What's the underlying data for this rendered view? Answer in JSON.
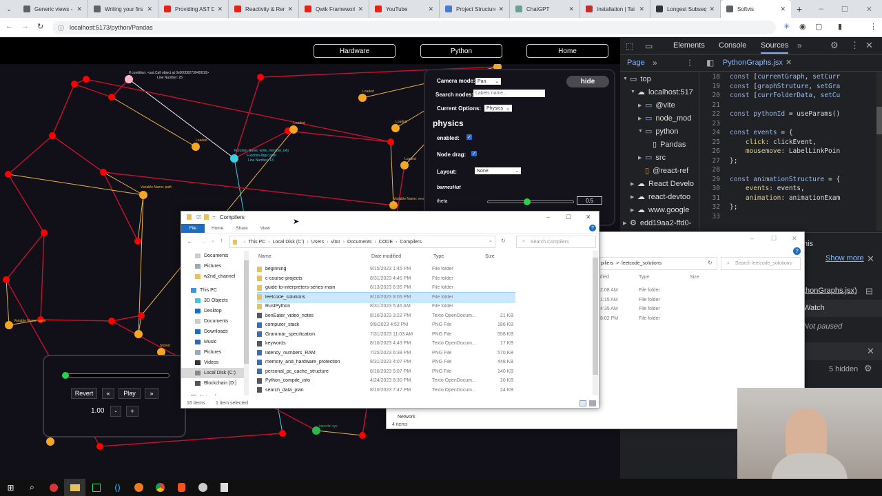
{
  "browser": {
    "tabs": [
      {
        "title": "Generic views - ",
        "icon": "globe-icon",
        "color": "#5f6368"
      },
      {
        "title": "Writing your firs",
        "icon": "globe-icon",
        "color": "#5f6368"
      },
      {
        "title": "Providing AST D",
        "icon": "youtube-icon",
        "color": "#e62117"
      },
      {
        "title": "Reactivity & Ren",
        "icon": "youtube-icon",
        "color": "#e62117"
      },
      {
        "title": "Qwik Framework",
        "icon": "youtube-icon",
        "color": "#e62117"
      },
      {
        "title": "YouTube",
        "icon": "youtube-icon",
        "color": "#e62117"
      },
      {
        "title": "Project Structure",
        "icon": "search-icon",
        "color": "#4a7bd0"
      },
      {
        "title": "ChatGPT",
        "icon": "chatgpt-icon",
        "color": "#6aa194"
      },
      {
        "title": "Installation | Tai",
        "icon": "t-icon",
        "color": "#c42d2d"
      },
      {
        "title": "Longest Subseq",
        "icon": "leetcode-icon",
        "color": "#333333"
      },
      {
        "title": "Softvis",
        "icon": "globe-icon",
        "color": "#5f6368",
        "active": true
      }
    ],
    "url": "localhost:5173/python/Pandas"
  },
  "app": {
    "nav": [
      "Hardware",
      "Python",
      "Home"
    ],
    "controls": {
      "camera_label": "Camera mode:",
      "camera_value": "Pan",
      "search_label": "Search nodes:",
      "search_placeholder": "Labels name...",
      "options_label": "Current Options:",
      "options_value": "Physics",
      "hide_label": "hide",
      "section_title": "physics",
      "enabled_label": "enabled:",
      "enabled": true,
      "drag_label": "Node drag:",
      "drag": true,
      "layout_label": "Layout:",
      "layout_value": "None",
      "solver_label": "barnesHut",
      "theta_label": "theta",
      "theta_value": "0.5",
      "theta_fraction": 0.45
    },
    "animation": {
      "progress": 0.0,
      "revert": "Revert",
      "prev": "«",
      "play": "Play",
      "next": "»",
      "speed": "1.00",
      "minus": "-",
      "plus": "+"
    },
    "graph_labels": {
      "if_condition": "If condition: <ast.Call object at 0x0000027304D810>",
      "if_line": "Line Number: 25",
      "function_name": "Function Name: write_member_info",
      "function_args": "Function Args: path",
      "function_line": "Line Number: 13",
      "loaded": "Loaded",
      "stored": "Stored",
      "var_path": "Variable Name: path",
      "var_version": "Variable Name: version",
      "var_open": "Variable Name: open",
      "imports_sys": "imports: sys"
    }
  },
  "explorer": {
    "title": "Compilers",
    "ribbon": [
      "File",
      "Home",
      "Share",
      "View"
    ],
    "breadcrumb": [
      "This PC",
      "Local Disk (C:)",
      "Users",
      "vitor",
      "Documents",
      "CODE",
      "Compilers"
    ],
    "search_placeholder": "Search Compilers",
    "columns": [
      "Name",
      "Date modified",
      "Type",
      "Size"
    ],
    "nav": [
      "Documents",
      "Pictures",
      "w2nd_channel",
      "This PC",
      "3D Objects",
      "Desktop",
      "Documents",
      "Downloads",
      "Music",
      "Pictures",
      "Videos",
      "Local Disk (C:)",
      "Blockchain (D:)",
      "Network"
    ],
    "files": [
      {
        "name": "beginning",
        "date": "9/15/2023 1:45 PM",
        "type": "File folder",
        "size": "",
        "kind": "folder"
      },
      {
        "name": "c-course-projects",
        "date": "8/31/2023 4:45 PM",
        "type": "File folder",
        "size": "",
        "kind": "folder"
      },
      {
        "name": "guide-to-interpreters-series-main",
        "date": "6/13/2023 6:35 PM",
        "type": "File folder",
        "size": "",
        "kind": "folder"
      },
      {
        "name": "leetcode_solutions",
        "date": "8/10/2023 8:05 PM",
        "type": "File folder",
        "size": "",
        "kind": "folder",
        "selected": true
      },
      {
        "name": "RustPython",
        "date": "8/31/2023 5:46 AM",
        "type": "File folder",
        "size": "",
        "kind": "folder"
      },
      {
        "name": "benEater_video_notes",
        "date": "8/16/2023 3:22 PM",
        "type": "Texto OpenDocum...",
        "size": "21 KB",
        "kind": "doc"
      },
      {
        "name": "computer_stack",
        "date": "9/8/2023 4:52 PM",
        "type": "PNG File",
        "size": "186 KB",
        "kind": "png"
      },
      {
        "name": "Grammar_specification",
        "date": "7/31/2023 11:03 AM",
        "type": "PNG File",
        "size": "558 KB",
        "kind": "png"
      },
      {
        "name": "keywords",
        "date": "8/16/2023 4:43 PM",
        "type": "Texto OpenDocum...",
        "size": "17 KB",
        "kind": "doc"
      },
      {
        "name": "latency_numbers_RAM",
        "date": "7/25/2023 6:38 PM",
        "type": "PNG File",
        "size": "570 KB",
        "kind": "png"
      },
      {
        "name": "memory_and_hardware_protection",
        "date": "8/31/2023 4:07 PM",
        "type": "PNG File",
        "size": "448 KB",
        "kind": "png"
      },
      {
        "name": "personal_pc_cache_structure",
        "date": "8/16/2023 5:07 PM",
        "type": "PNG File",
        "size": "140 KB",
        "kind": "png"
      },
      {
        "name": "Python_compile_info",
        "date": "4/24/2023 8:30 PM",
        "type": "Texto OpenDocum...",
        "size": "20 KB",
        "kind": "doc"
      },
      {
        "name": "search_data_plan",
        "date": "8/10/2023 7:47 PM",
        "type": "Texto OpenDocum...",
        "size": "24 KB",
        "kind": "doc"
      }
    ],
    "status_items": "16 items",
    "status_selected": "1 item selected"
  },
  "explorer2": {
    "breadcrumb_tail": "piliers  >  leetcode_solutions",
    "search_placeholder": "Search leetcode_solutions",
    "columns": [
      "ified",
      "Type",
      "Size"
    ],
    "rows": [
      {
        "date": "2:08 AM",
        "type": "File folder"
      },
      {
        "date": "1:15 AM",
        "type": "File folder"
      },
      {
        "date": "4:35 AM",
        "type": "File folder"
      },
      {
        "date": "8:02 PM",
        "type": "File folder"
      }
    ],
    "network": "Network",
    "status": "4 items"
  },
  "devtools": {
    "tabs": [
      "Elements",
      "Console",
      "Sources"
    ],
    "active_tab": "Sources",
    "subtab": "Page",
    "file_tab": "PythonGraphs.jsx",
    "tree": [
      {
        "label": "top",
        "depth": 0,
        "icon": "frame-icon",
        "open": true
      },
      {
        "label": "localhost:517",
        "depth": 1,
        "icon": "cloud-icon",
        "open": true
      },
      {
        "label": "@vite",
        "depth": 2,
        "icon": "folder-icon",
        "open": false
      },
      {
        "label": "node_mod",
        "depth": 2,
        "icon": "folder-icon",
        "open": false
      },
      {
        "label": "python",
        "depth": 2,
        "icon": "folder-icon",
        "open": true
      },
      {
        "label": "Pandas",
        "depth": 3,
        "icon": "file-icon"
      },
      {
        "label": "src",
        "depth": 2,
        "icon": "folder-icon",
        "open": false
      },
      {
        "label": "@react-ref",
        "depth": 2,
        "icon": "file-icon-orange"
      },
      {
        "label": "React Develo",
        "depth": 1,
        "icon": "cloud-icon",
        "open": false
      },
      {
        "label": "react-devtoo",
        "depth": 1,
        "icon": "cloud-icon",
        "open": false
      },
      {
        "label": "www.google",
        "depth": 1,
        "icon": "cloud-icon",
        "open": false
      },
      {
        "label": "edd19aa2-ffd0-",
        "depth": 0,
        "icon": "gear-icon",
        "open": false
      }
    ],
    "code": [
      {
        "n": "18",
        "t": [
          [
            "kw",
            "const "
          ],
          [
            "tx",
            "["
          ],
          [
            "vr",
            "currentGraph"
          ],
          [
            "tx",
            ", "
          ],
          [
            "vr",
            "setCurr"
          ]
        ]
      },
      {
        "n": "19",
        "t": [
          [
            "kw",
            "const "
          ],
          [
            "tx",
            "["
          ],
          [
            "vr",
            "graphStruture"
          ],
          [
            "tx",
            ", "
          ],
          [
            "vr",
            "setGra"
          ]
        ]
      },
      {
        "n": "20",
        "t": [
          [
            "kw",
            "const "
          ],
          [
            "tx",
            "["
          ],
          [
            "vr",
            "currFolderData"
          ],
          [
            "tx",
            ", "
          ],
          [
            "vr",
            "setCu"
          ]
        ]
      },
      {
        "n": "21",
        "t": []
      },
      {
        "n": "22",
        "t": [
          [
            "kw",
            "const "
          ],
          [
            "vr",
            "pythonId"
          ],
          [
            "tx",
            " = useParams()"
          ]
        ]
      },
      {
        "n": "23",
        "t": []
      },
      {
        "n": "24",
        "t": [
          [
            "kw",
            "const "
          ],
          [
            "vr",
            "events"
          ],
          [
            "tx",
            " = {"
          ]
        ]
      },
      {
        "n": "25",
        "t": [
          [
            "tx",
            "    "
          ],
          [
            "pr",
            "click"
          ],
          [
            "tx",
            ": clickEvent,"
          ]
        ]
      },
      {
        "n": "26",
        "t": [
          [
            "tx",
            "    "
          ],
          [
            "pr",
            "mousemove"
          ],
          [
            "tx",
            ": LabelLinkPoin"
          ]
        ]
      },
      {
        "n": "27",
        "t": [
          [
            "tx",
            "};"
          ]
        ]
      },
      {
        "n": "28",
        "t": []
      },
      {
        "n": "29",
        "t": [
          [
            "kw",
            "const "
          ],
          [
            "vr",
            "animationStructure"
          ],
          [
            "tx",
            " = {"
          ]
        ]
      },
      {
        "n": "30",
        "t": [
          [
            "tx",
            "    "
          ],
          [
            "pr",
            "events"
          ],
          [
            "tx",
            ": events,"
          ]
        ]
      },
      {
        "n": "31",
        "t": [
          [
            "tx",
            "    "
          ],
          [
            "pr",
            "animation"
          ],
          [
            "tx",
            ": animationExam"
          ]
        ]
      },
      {
        "n": "32",
        "t": [
          [
            "tx",
            "};"
          ]
        ]
      },
      {
        "n": "33",
        "t": []
      }
    ],
    "lower": {
      "this": "his",
      "show_more": "Show more",
      "callstack_file": "thonGraphs.jsx)",
      "watch": "Watch",
      "not_paused": "Not paused",
      "hidden": "5 hidden"
    }
  },
  "taskbar": [
    "windows-start-icon",
    "search-icon",
    "app-icon",
    "file-explorer-icon",
    "pycharm-icon",
    "vscode-icon",
    "firefox-icon",
    "chrome-icon",
    "brave-icon",
    "clock-app-icon",
    "notepad-icon"
  ]
}
